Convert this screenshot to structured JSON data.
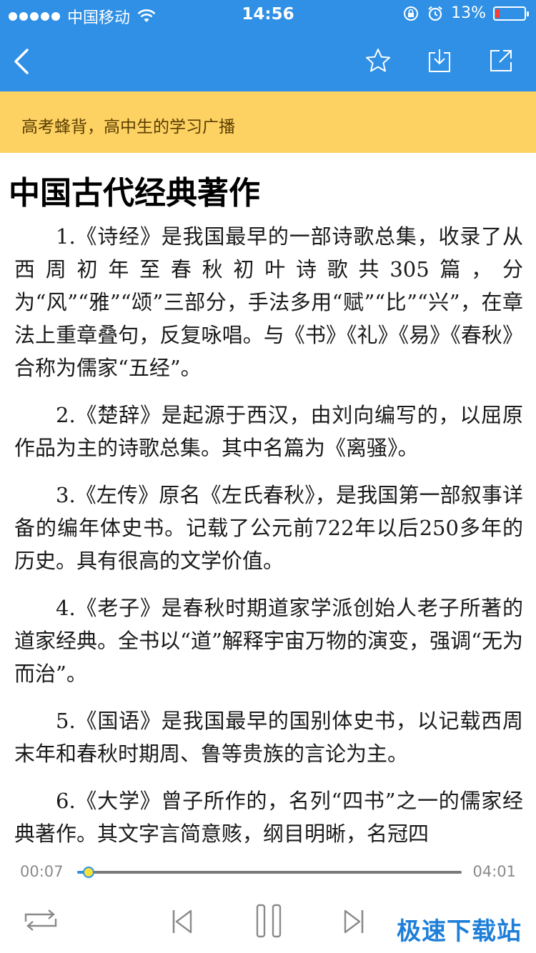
{
  "status_bar": {
    "carrier": "中国移动",
    "time": "14:56",
    "battery_percent": "13%",
    "battery_level": 0.13,
    "icons": [
      "signal-dots",
      "wifi-icon",
      "rotation-lock-icon",
      "alarm-icon",
      "battery-icon"
    ]
  },
  "nav": {
    "icons": [
      "back-chevron-icon",
      "star-icon",
      "download-icon",
      "share-icon"
    ]
  },
  "banner": {
    "text": "高考蜂背，高中生的学习广播"
  },
  "article": {
    "title": "中国古代经典著作",
    "paragraphs": [
      "1.《诗经》是我国最早的一部诗歌总集，收录了从西周初年至春秋初叶诗歌共305篇，分为“风”“雅”“颂”三部分，手法多用“赋”“比”“兴”，在章法上重章叠句，反复咏唱。与《书》《礼》《易》《春秋》合称为儒家“五经”。",
      "2.《楚辞》是起源于西汉，由刘向编写的，以屈原作品为主的诗歌总集。其中名篇为《离骚》。",
      "3.《左传》原名《左氏春秋》，是我国第一部叙事详备的编年体史书。记载了公元前722年以后250多年的历史。具有很高的文学价值。",
      "4.《老子》是春秋时期道家学派创始人老子所著的道家经典。全书以“道”解释宇宙万物的演变，强调“无为而治”。",
      "5.《国语》是我国最早的国别体史书，以记载西周末年和春秋时期周、鲁等贵族的言论为主。",
      "6.《大学》曾子所作的，名列“四书”之一的儒家经典著作。其文字言简意赅，纲目明晰，名冠四"
    ]
  },
  "player": {
    "current_time": "00:07",
    "total_time": "04:01",
    "progress": 0.029,
    "controls": [
      "repeat-icon",
      "previous-icon",
      "pause-icon",
      "next-icon"
    ]
  },
  "watermark": {
    "text": "极速下载站"
  },
  "colors": {
    "header_blue": "#2f90e6",
    "banner_yellow": "#fdd263",
    "battery_red": "#ff3b30",
    "watermark_blue": "#1e7fd8"
  }
}
